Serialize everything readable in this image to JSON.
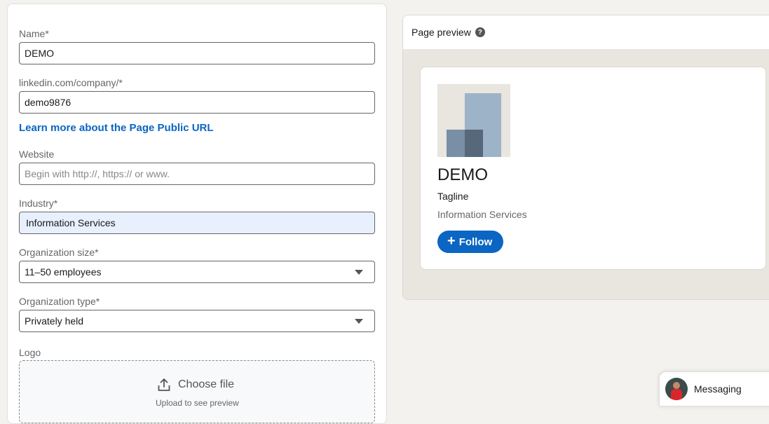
{
  "form": {
    "name": {
      "label": "Name*",
      "value": "DEMO"
    },
    "public_url": {
      "label": "linkedin.com/company/*",
      "value": "demo9876"
    },
    "learn_more_link": "Learn more about the Page Public URL",
    "website": {
      "label": "Website",
      "value": "",
      "placeholder": "Begin with http://, https:// or www."
    },
    "industry": {
      "label": "Industry*",
      "value": "Information Services"
    },
    "org_size": {
      "label": "Organization size*",
      "value": "11–50 employees"
    },
    "org_type": {
      "label": "Organization type*",
      "value": "Privately held"
    },
    "logo": {
      "label": "Logo",
      "upload_label": "Choose file",
      "upload_hint": "Upload to see preview"
    }
  },
  "preview": {
    "title": "Page preview",
    "help_icon": "question-circle-icon",
    "company_name": "DEMO",
    "tagline": "Tagline",
    "industry": "Information Services",
    "follow_label": "Follow"
  },
  "messaging": {
    "label": "Messaging"
  },
  "colors": {
    "accent": "#0a66c2",
    "page_bg": "#f4f2ee",
    "preview_bg": "#e9e5df",
    "input_highlight": "#e8f0fe"
  }
}
